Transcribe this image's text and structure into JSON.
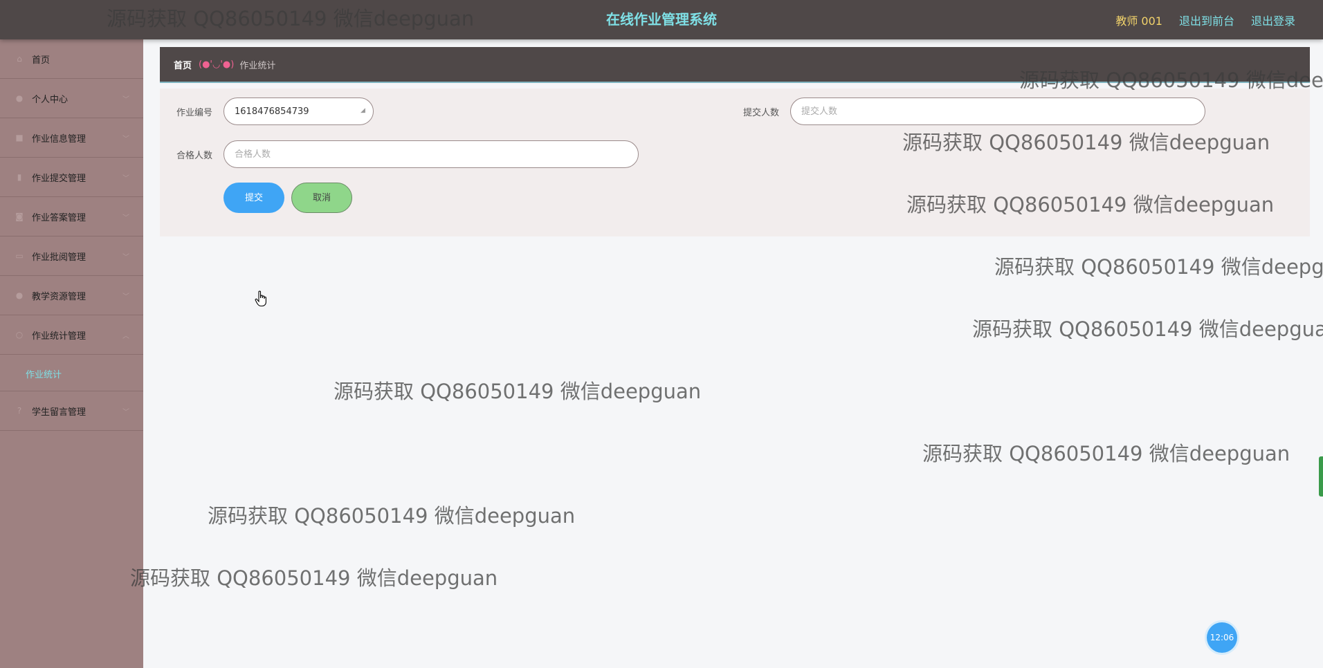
{
  "header": {
    "title": "在线作业管理系统",
    "user": "教师 001",
    "links": [
      "退出到前台",
      "退出登录"
    ]
  },
  "sidebar": {
    "items": [
      {
        "label": "首页",
        "icon": "home-icon"
      },
      {
        "label": "个人中心",
        "icon": "user-icon"
      },
      {
        "label": "作业信息管理",
        "icon": "video-icon"
      },
      {
        "label": "作业提交管理",
        "icon": "mic-icon"
      },
      {
        "label": "作业答案管理",
        "icon": "camera-icon"
      },
      {
        "label": "作业批阅管理",
        "icon": "folder-icon"
      },
      {
        "label": "教学资源管理",
        "icon": "person-icon"
      },
      {
        "label": "作业统计管理",
        "icon": "location-icon"
      },
      {
        "label": "学生留言管理",
        "icon": "help-icon"
      }
    ],
    "active_subitem": "作业统计"
  },
  "breadcrumb": {
    "home": "首页",
    "separator": "(●'◡'●)",
    "current": "作业统计"
  },
  "form": {
    "fields": {
      "homework_no": {
        "label": "作业编号",
        "value": "1618476854739"
      },
      "submit_count": {
        "label": "提交人数",
        "placeholder": "提交人数"
      },
      "qualified_count": {
        "label": "合格人数",
        "placeholder": "合格人数"
      }
    },
    "submit_label": "提交",
    "cancel_label": "取消"
  },
  "watermark": "源码获取 QQ86050149 微信deepguan",
  "clock": "12:06",
  "colors": {
    "topbar": "#4f4848",
    "title": "#7fe0e6",
    "user": "#f2d36b",
    "sidebar": "#9e8181",
    "submit": "#3fa5f5",
    "cancel": "#8fd68a"
  }
}
